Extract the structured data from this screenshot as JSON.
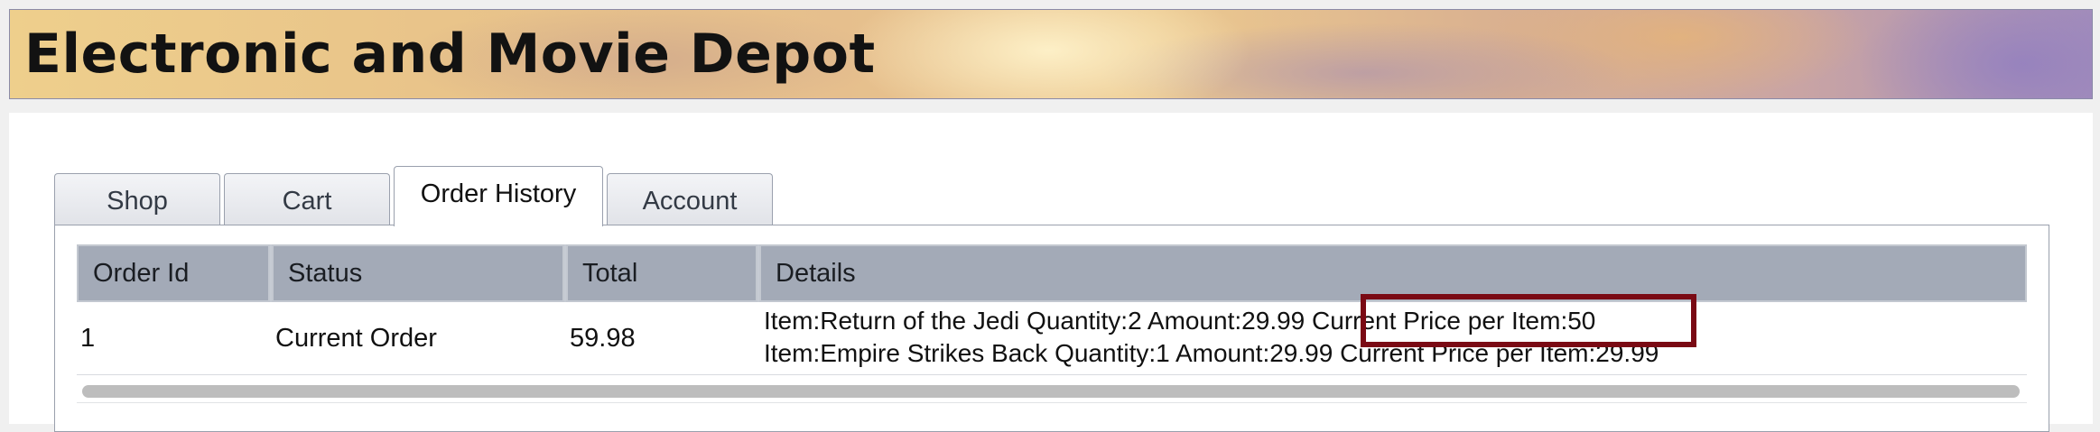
{
  "header": {
    "title": "Electronic and Movie Depot"
  },
  "tabs": [
    {
      "label": "Shop",
      "active": false
    },
    {
      "label": "Cart",
      "active": false
    },
    {
      "label": "Order History",
      "active": true
    },
    {
      "label": "Account",
      "active": false
    }
  ],
  "orders_table": {
    "columns": [
      "Order Id",
      "Status",
      "Total",
      "Details"
    ],
    "rows": [
      {
        "order_id": "1",
        "status": "Current Order",
        "total": "59.98",
        "details": [
          {
            "item_text": "Item:Return of the Jedi Quantity:2 Amount:29.99 ",
            "price_text": "Current Price per Item:50"
          },
          {
            "item_text": "Item:Empire Strikes Back Quantity:1 Amount:29.99 ",
            "price_text": "Current Price per Item:29.99"
          }
        ]
      }
    ]
  },
  "annotation": {
    "highlight_color": "#7a0a14",
    "target": "Current Price per Item:50"
  },
  "colors": {
    "header_cell": "#a3aab7",
    "highlight": "#7a0a14"
  }
}
